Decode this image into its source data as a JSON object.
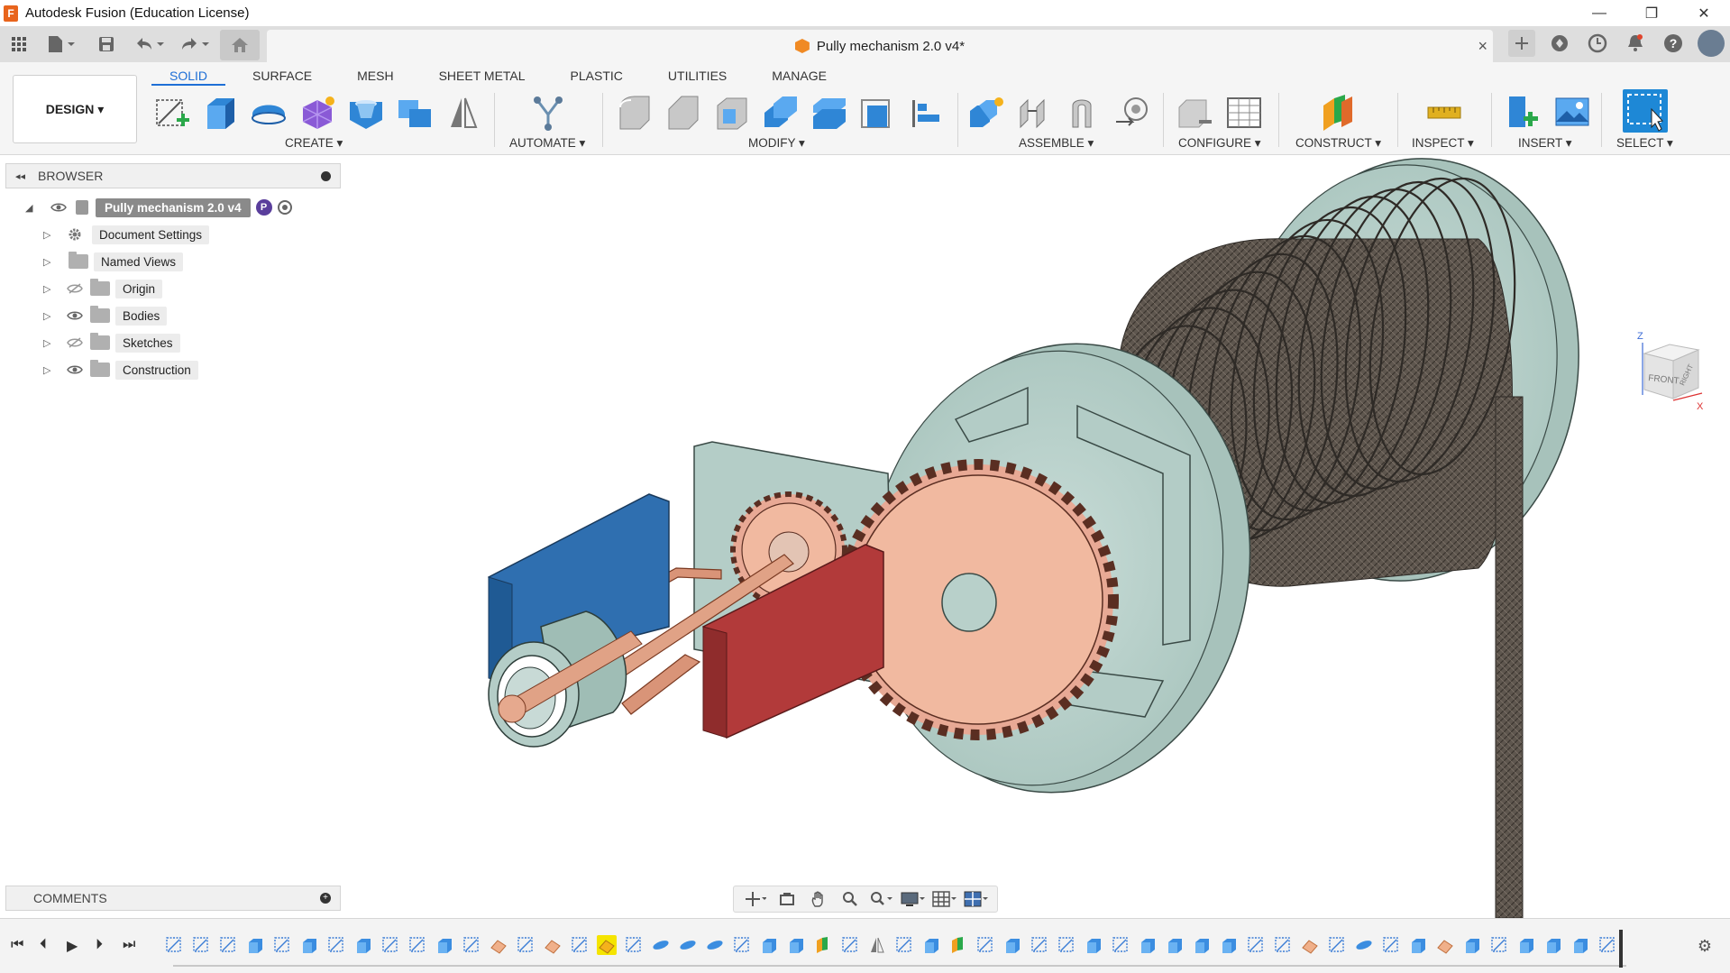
{
  "app": {
    "title": "Autodesk Fusion (Education License)",
    "icon_letter": "F"
  },
  "window_controls": {
    "minimize": "—",
    "restore": "❐",
    "close": "✕"
  },
  "document": {
    "tab_title": "Pully mechanism 2.0 v4*",
    "close": "×"
  },
  "ribbon": {
    "workspace_button": "DESIGN ▾",
    "tabs": [
      "SOLID",
      "SURFACE",
      "MESH",
      "SHEET METAL",
      "PLASTIC",
      "UTILITIES",
      "MANAGE"
    ],
    "active_tab": "SOLID",
    "groups": {
      "create": "CREATE ▾",
      "automate": "AUTOMATE ▾",
      "modify": "MODIFY ▾",
      "assemble": "ASSEMBLE ▾",
      "configure": "CONFIGURE ▾",
      "construct": "CONSTRUCT ▾",
      "inspect": "INSPECT ▾",
      "insert": "INSERT ▾",
      "select": "SELECT ▾"
    }
  },
  "browser": {
    "title": "BROWSER",
    "root": "Pully mechanism 2.0 v4",
    "items": [
      {
        "label": "Document Settings",
        "icon": "gear-icon"
      },
      {
        "label": "Named Views",
        "icon": "folder-icon"
      },
      {
        "label": "Origin",
        "icon": "folder-icon",
        "visible": false
      },
      {
        "label": "Bodies",
        "icon": "folder-icon",
        "visible": true
      },
      {
        "label": "Sketches",
        "icon": "folder-icon",
        "visible": false
      },
      {
        "label": "Construction",
        "icon": "folder-icon",
        "visible": true
      }
    ]
  },
  "comments": {
    "title": "COMMENTS"
  },
  "viewcube": {
    "front": "FRONT",
    "right": "RIGHT",
    "axis_z": "Z",
    "axis_x": "X"
  },
  "colors": {
    "accent": "#1e6fd6",
    "blue_block": "#2f6fb0",
    "red_block": "#b23a3a",
    "gear": "#f1b9a0",
    "drum": "#b9d3cc",
    "rope": "#5e564e",
    "timeline_highlight": "#f5e400"
  },
  "timeline": {
    "item_count": 54,
    "highlight_index": 16
  }
}
